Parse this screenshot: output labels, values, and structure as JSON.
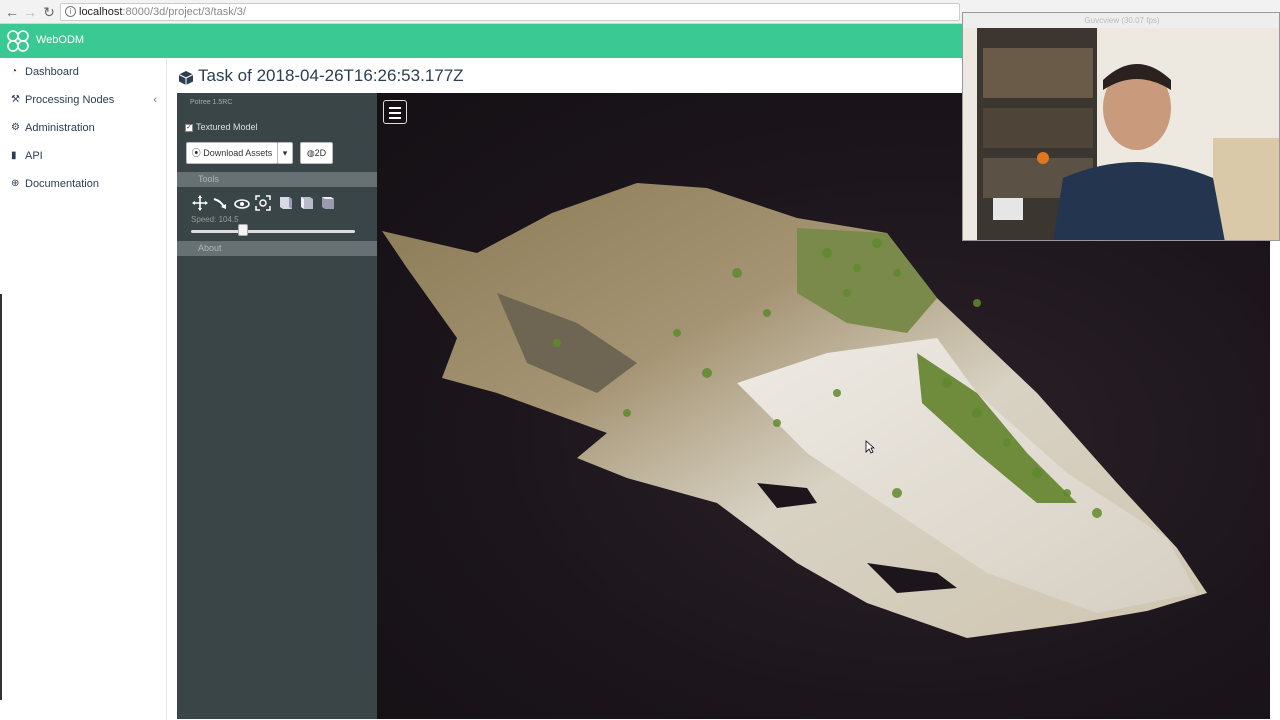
{
  "browser": {
    "url_host": "localhost",
    "url_path": ":8000/3d/project/3/task/3/"
  },
  "app": {
    "brand": "WebODM"
  },
  "sidebar": {
    "items": [
      {
        "label": "Dashboard",
        "icon": "dashboard-icon"
      },
      {
        "label": "Processing Nodes",
        "icon": "wrench-icon"
      },
      {
        "label": "Administration",
        "icon": "cogs-icon"
      },
      {
        "label": "API",
        "icon": "book-icon"
      },
      {
        "label": "Documentation",
        "icon": "lifebuoy-icon"
      }
    ],
    "collapse_chevron": "‹"
  },
  "page": {
    "title": "Task of 2018-04-26T16:26:53.177Z"
  },
  "potree": {
    "version": "Potree 1.5RC",
    "textured_label": "Textured Model",
    "textured_checked": true,
    "download_label": "Download Assets",
    "twod_label": "2D",
    "tools_header": "Tools",
    "speed_label": "Speed: 104.5",
    "speed_value": 104.5,
    "about_header": "About"
  },
  "webcam": {
    "title": "Guvcview (30.07 fps)"
  },
  "colors": {
    "accent": "#3bc993",
    "panel": "#3a4547",
    "viewer_bg": "#1c161c"
  }
}
